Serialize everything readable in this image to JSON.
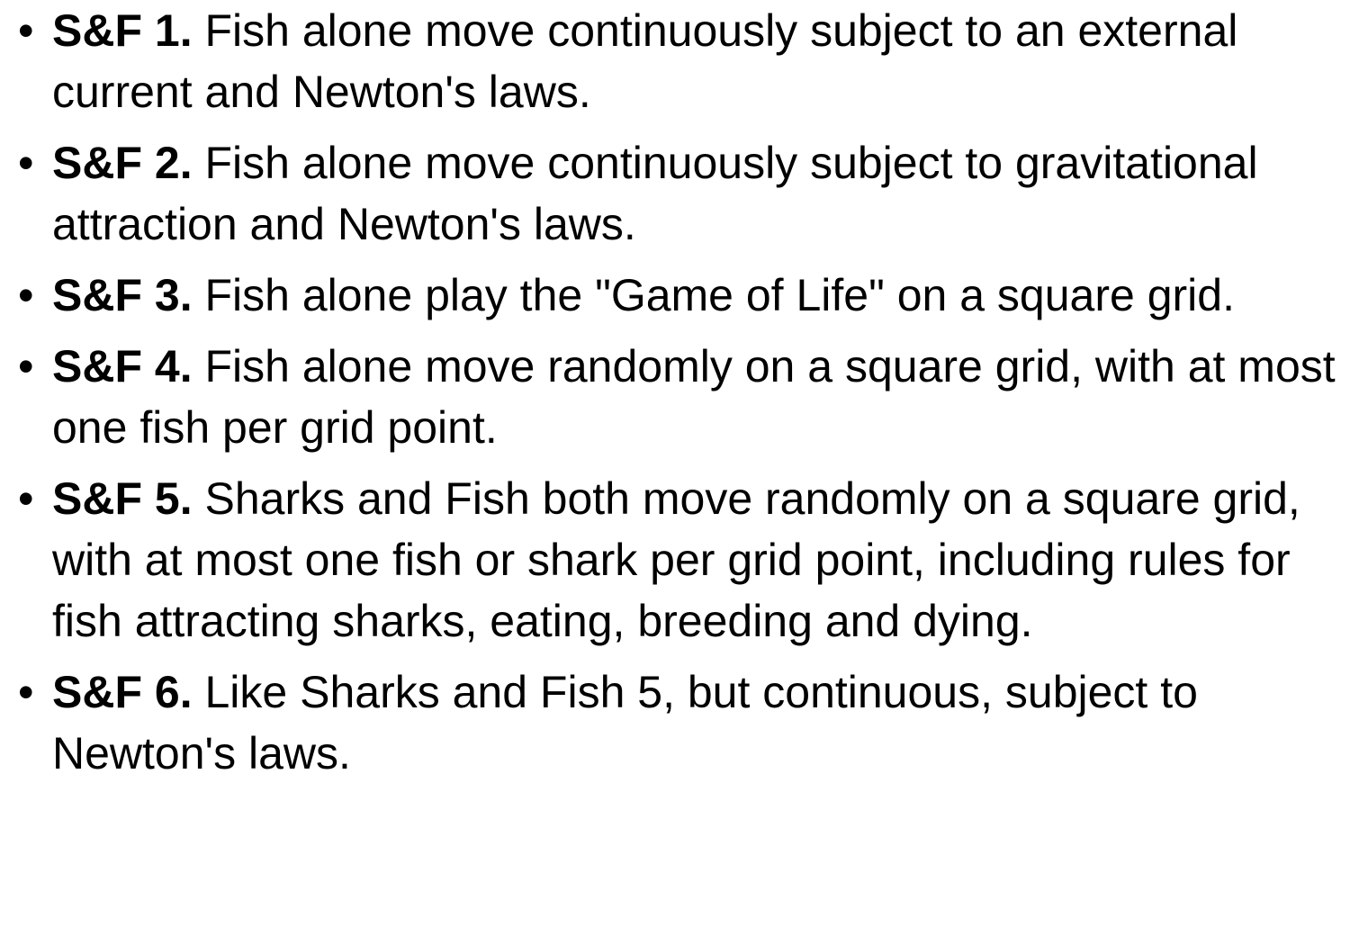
{
  "items": [
    {
      "bullet": "•",
      "label": "S&F 1.",
      "text": "Fish alone move continuously subject to an external current and Newton's laws."
    },
    {
      "bullet": "•",
      "label": "S&F 2.",
      "text": "Fish alone move continuously subject to gravitational attraction and Newton's laws."
    },
    {
      "bullet": "•",
      "label": "S&F 3.",
      "text": "Fish alone play the \"Game of Life\" on a square grid."
    },
    {
      "bullet": "•",
      "label": "S&F 4.",
      "text": "Fish alone move randomly on a square grid, with at most one fish per grid point."
    },
    {
      "bullet": "•",
      "label": "S&F 5.",
      "text": "Sharks and Fish both move randomly on a square grid, with at most one fish or shark per grid point, including rules for fish attracting sharks, eating, breeding and dying."
    },
    {
      "bullet": "•",
      "label": "S&F 6.",
      "text": "Like Sharks and Fish 5, but continuous, subject to Newton's laws."
    }
  ]
}
